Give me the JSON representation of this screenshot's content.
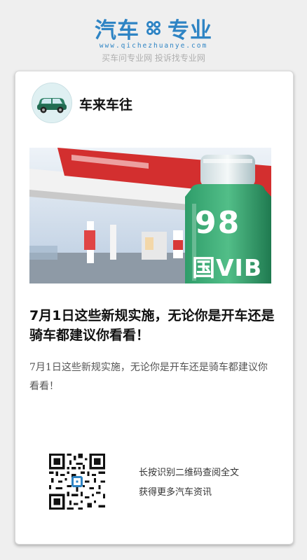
{
  "brand": {
    "left_word": "汽车",
    "right_word": "专业",
    "url": "www.qichezhuanye.com",
    "slogan": "买车问专业网 投诉找专业网",
    "brand_color": "#2e84c4",
    "gear_icon": "gear-icon"
  },
  "article": {
    "author": "车来车往",
    "avatar_icon": "car-icon",
    "cover_image": {
      "sign_number": "98",
      "sign_text": "国VIB",
      "station_color": "#d32f2f",
      "bottle_color": "#1e8d5a"
    },
    "title": "7月1日这些新规实施，无论你是开车还是骑车都建议你看看！",
    "summary": "7月1日这些新规实施，无论你是开车还是骑车都建议你看看！"
  },
  "footer": {
    "qr_icon": "qr-code-icon",
    "caption_line1": "长按识别二维码查阅全文",
    "caption_line2": "获得更多汽车资讯"
  }
}
